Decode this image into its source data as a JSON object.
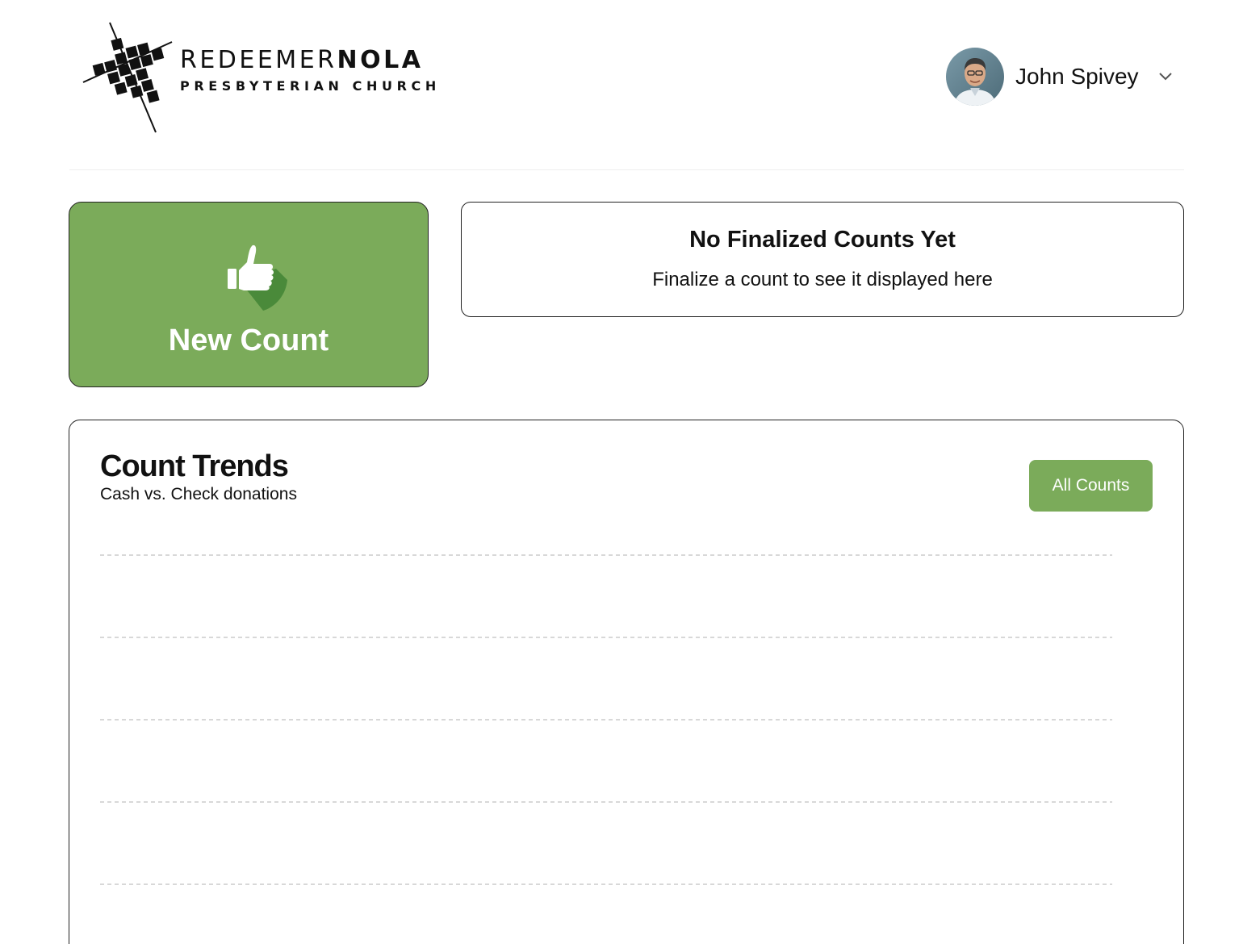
{
  "brand": {
    "name_light": "REDEEMER",
    "name_bold": "NOLA",
    "tagline": "PRESBYTERIAN CHURCH"
  },
  "user": {
    "name": "John Spivey"
  },
  "new_count": {
    "label": "New Count",
    "icon": "thumbs-up-icon"
  },
  "finalized": {
    "title": "No Finalized Counts Yet",
    "subtitle": "Finalize a count to see it displayed here"
  },
  "trends": {
    "title": "Count Trends",
    "subtitle": "Cash vs. Check donations",
    "all_counts_label": "All Counts"
  },
  "chart_data": {
    "type": "line",
    "title": "",
    "series": [],
    "categories": [],
    "grid": true,
    "gridlines": 5
  },
  "colors": {
    "accent": "#7bab5a",
    "accent_dark": "#4a8a3a",
    "grid": "#cccccc"
  }
}
